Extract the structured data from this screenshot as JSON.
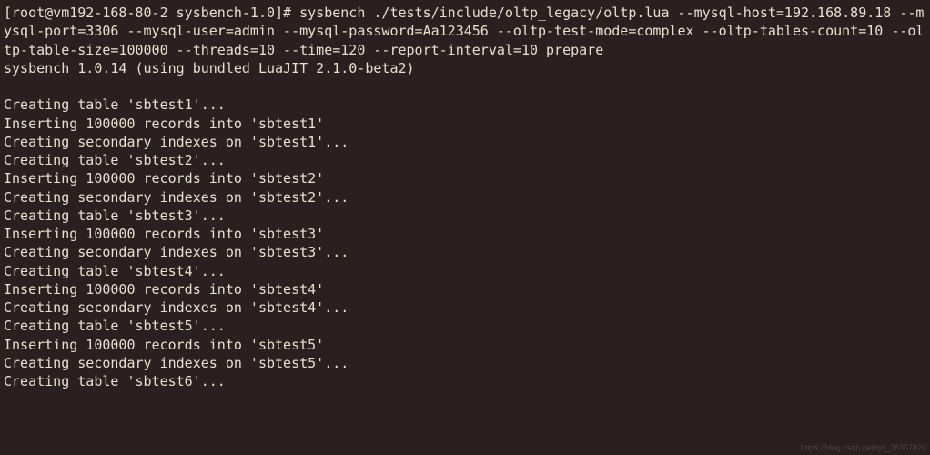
{
  "prompt": "[root@vm192-168-80-2 sysbench-1.0]# ",
  "command": "sysbench ./tests/include/oltp_legacy/oltp.lua --mysql-host=192.168.89.18 --mysql-port=3306 --mysql-user=admin --mysql-password=Aa123456 --oltp-test-mode=complex --oltp-tables-count=10 --oltp-table-size=100000 --threads=10 --time=120 --report-interval=10 prepare",
  "version_line": "sysbench 1.0.14 (using bundled LuaJIT 2.1.0-beta2)",
  "output_lines": [
    "Creating table 'sbtest1'...",
    "Inserting 100000 records into 'sbtest1'",
    "Creating secondary indexes on 'sbtest1'...",
    "Creating table 'sbtest2'...",
    "Inserting 100000 records into 'sbtest2'",
    "Creating secondary indexes on 'sbtest2'...",
    "Creating table 'sbtest3'...",
    "Inserting 100000 records into 'sbtest3'",
    "Creating secondary indexes on 'sbtest3'...",
    "Creating table 'sbtest4'...",
    "Inserting 100000 records into 'sbtest4'",
    "Creating secondary indexes on 'sbtest4'...",
    "Creating table 'sbtest5'...",
    "Inserting 100000 records into 'sbtest5'",
    "Creating secondary indexes on 'sbtest5'...",
    "Creating table 'sbtest6'..."
  ],
  "watermark": "https://blog.csdn.net/qq_36357820"
}
